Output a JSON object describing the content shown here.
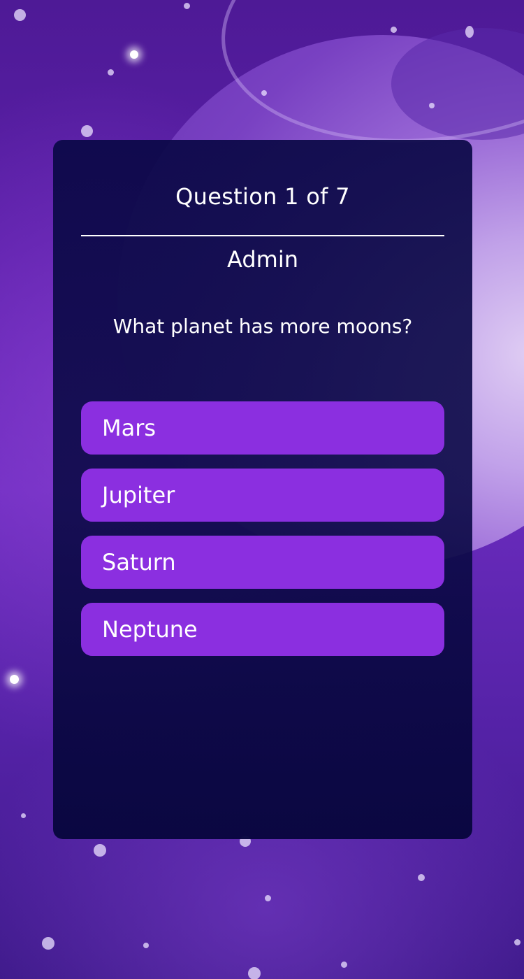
{
  "quiz": {
    "progress_label": "Question 1 of 7",
    "author": "Admin",
    "question": "What planet has more moons?",
    "answers": [
      {
        "label": "Mars"
      },
      {
        "label": "Jupiter"
      },
      {
        "label": "Saturn"
      },
      {
        "label": "Neptune"
      }
    ]
  },
  "colors": {
    "background": "#5a1fa8",
    "card": "#0c0a48",
    "answer_button": "#8b2fe0",
    "text": "#ffffff"
  }
}
